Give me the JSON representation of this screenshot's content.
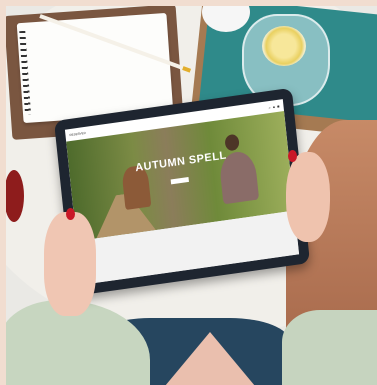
{
  "photo": {
    "description_colors": {
      "table": "#f1efea",
      "tray": "#7a5640",
      "teal": "#2f8a8a",
      "nails": "#c91827"
    },
    "tablet_site": {
      "brand": "RESERVED",
      "nav_links": [
        "",
        "",
        "",
        "",
        "",
        ""
      ],
      "hero_title": "AUTUMN SPELL",
      "hero_subtitle": "",
      "hero_button": ""
    }
  }
}
